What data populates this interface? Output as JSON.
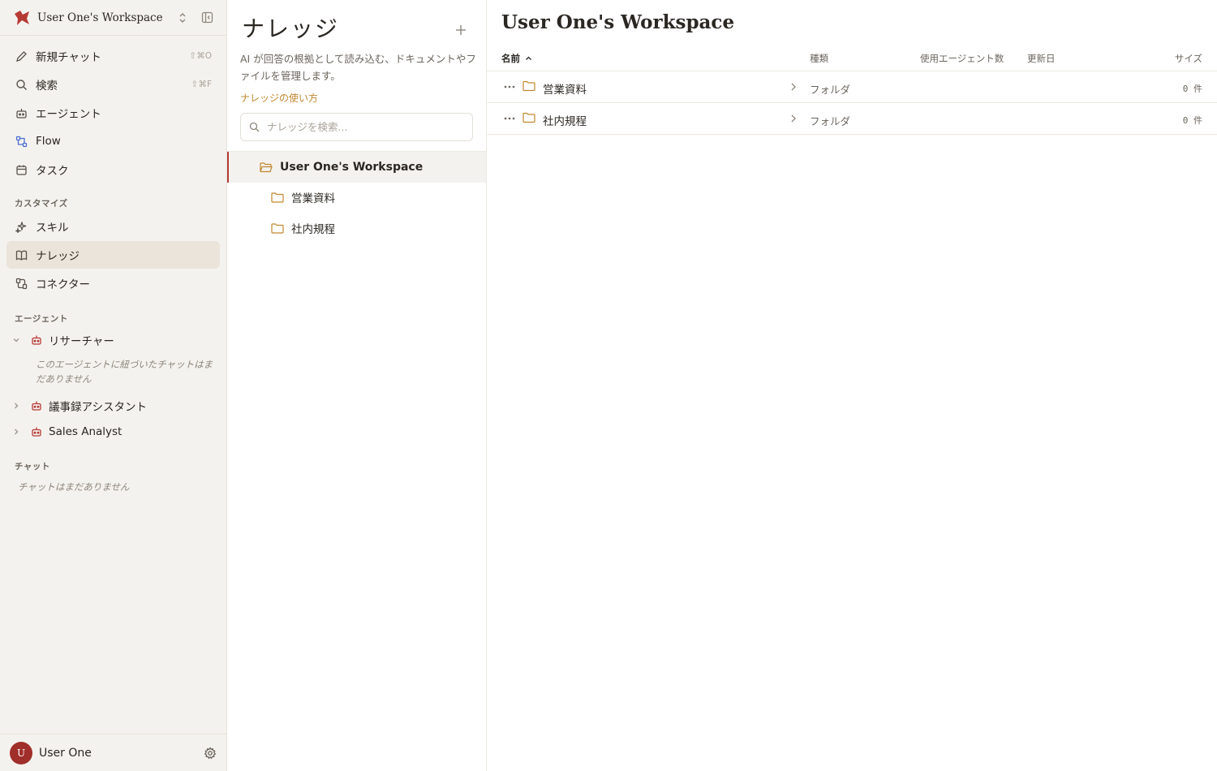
{
  "sidebar": {
    "workspace_name": "User One's Workspace",
    "nav": [
      {
        "label": "新規チャット",
        "shortcut": "⇧⌘O",
        "icon": "pencil-icon"
      },
      {
        "label": "検索",
        "shortcut": "⇧⌘F",
        "icon": "search-icon"
      },
      {
        "label": "エージェント",
        "icon": "robot-icon"
      },
      {
        "label": "Flow",
        "icon": "flow-icon"
      },
      {
        "label": "タスク",
        "icon": "calendar-icon"
      }
    ],
    "customize_title": "カスタマイズ",
    "customize": [
      {
        "label": "スキル",
        "icon": "sparkle-icon"
      },
      {
        "label": "ナレッジ",
        "icon": "book-icon",
        "active": true
      },
      {
        "label": "コネクター",
        "icon": "connector-icon"
      }
    ],
    "agents_title": "エージェント",
    "agents": [
      {
        "label": "リサーチャー",
        "expanded": true
      },
      {
        "label": "議事録アシスタント",
        "expanded": false
      },
      {
        "label": "Sales Analyst",
        "expanded": false
      }
    ],
    "agent_empty": "このエージェントに紐づいたチャットはまだありません",
    "chat_title": "チャット",
    "chat_empty": "チャットはまだありません",
    "user_name": "User One",
    "user_initial": "U"
  },
  "knowledge": {
    "title": "ナレッジ",
    "description": "AI が回答の根拠として読み込む、ドキュメントやファイルを管理します。",
    "help_link": "ナレッジの使い方",
    "search_placeholder": "ナレッジを検索...",
    "tree_root": "User One's Workspace",
    "tree_items": [
      "営業資料",
      "社内規程"
    ]
  },
  "main": {
    "title": "User One's Workspace",
    "columns": {
      "name": "名前",
      "type": "種類",
      "agents": "使用エージェント数",
      "updated": "更新日",
      "size": "サイズ"
    },
    "rows": [
      {
        "name": "営業資料",
        "type": "フォルダ",
        "agents": "",
        "updated": "",
        "size": "0 件"
      },
      {
        "name": "社内規程",
        "type": "フォルダ",
        "agents": "",
        "updated": "",
        "size": "0 件"
      }
    ]
  },
  "colors": {
    "accent": "#b53a34",
    "folder": "#c2872f",
    "sidebar_bg": "#f4f2ee",
    "active_bg": "#ebe4da"
  }
}
